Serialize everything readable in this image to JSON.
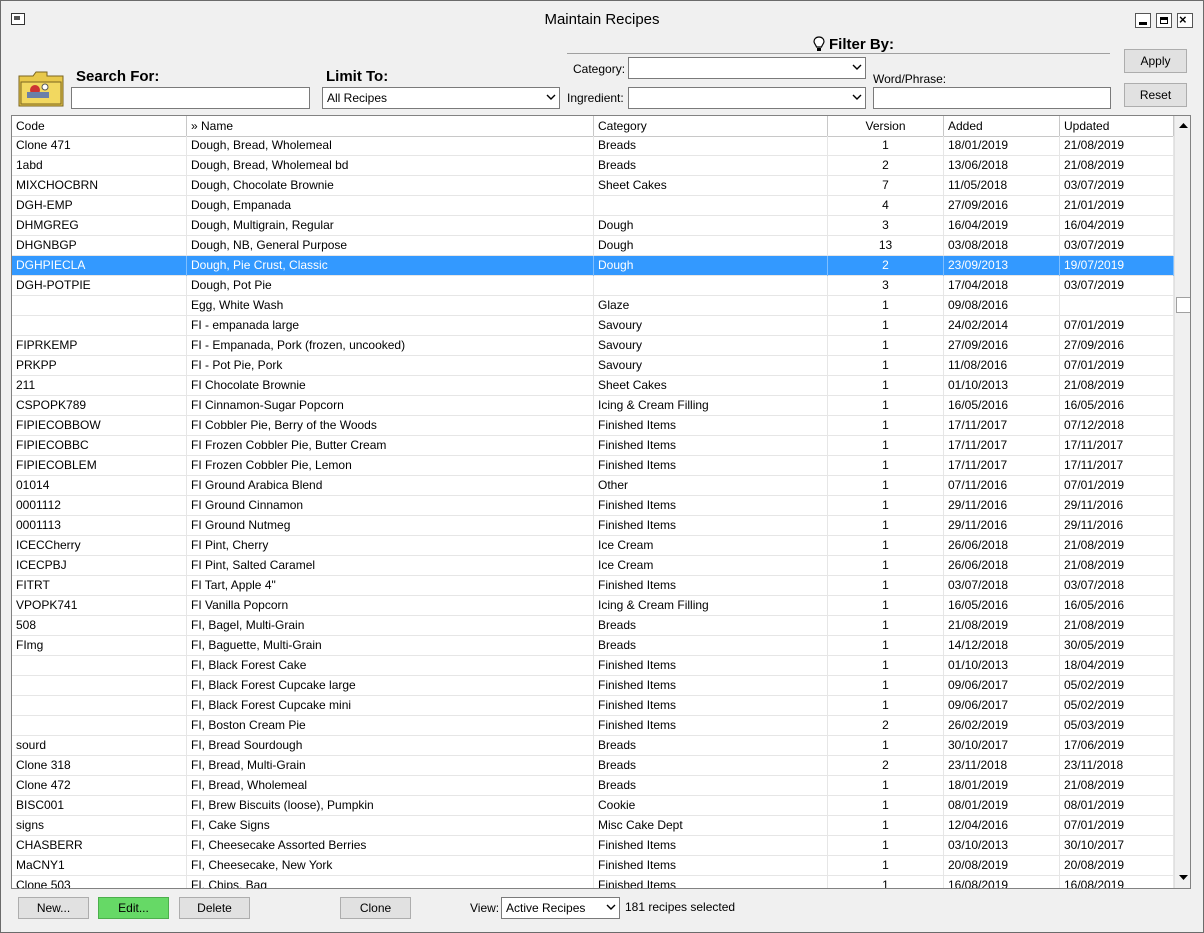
{
  "window": {
    "title": "Maintain Recipes"
  },
  "search": {
    "label": "Search For:",
    "value": ""
  },
  "limit": {
    "label": "Limit To:",
    "value": "All Recipes"
  },
  "filter": {
    "title": "Filter By:",
    "category_label": "Category:",
    "category_value": "",
    "ingredient_label": "Ingredient:",
    "ingredient_value": "",
    "word_label": "Word/Phrase:",
    "word_value": ""
  },
  "buttons": {
    "apply": "Apply",
    "reset": "Reset",
    "new": "New...",
    "edit": "Edit...",
    "delete": "Delete",
    "clone": "Clone"
  },
  "grid": {
    "columns": [
      "Code",
      "» Name",
      "Category",
      "Version",
      "Added",
      "Updated"
    ],
    "selected_index": 6,
    "rows": [
      [
        "Clone 471",
        "Dough, Bread, Wholemeal",
        "Breads",
        "1",
        "18/01/2019",
        "21/08/2019"
      ],
      [
        "1abd",
        "Dough, Bread, Wholemeal bd",
        "Breads",
        "2",
        "13/06/2018",
        "21/08/2019"
      ],
      [
        "MIXCHOCBRN",
        "Dough, Chocolate Brownie",
        "Sheet Cakes",
        "7",
        "11/05/2018",
        "03/07/2019"
      ],
      [
        "DGH-EMP",
        "Dough, Empanada",
        "",
        "4",
        "27/09/2016",
        "21/01/2019"
      ],
      [
        "DHMGREG",
        "Dough, Multigrain, Regular",
        "Dough",
        "3",
        "16/04/2019",
        "16/04/2019"
      ],
      [
        "DHGNBGP",
        "Dough, NB, General Purpose",
        "Dough",
        "13",
        "03/08/2018",
        "03/07/2019"
      ],
      [
        "DGHPIECLA",
        "Dough, Pie Crust, Classic",
        "Dough",
        "2",
        "23/09/2013",
        "19/07/2019"
      ],
      [
        "DGH-POTPIE",
        "Dough, Pot Pie",
        "",
        "3",
        "17/04/2018",
        "03/07/2019"
      ],
      [
        "",
        "Egg, White Wash",
        "Glaze",
        "1",
        "09/08/2016",
        ""
      ],
      [
        "",
        "FI - empanada large",
        "Savoury",
        "1",
        "24/02/2014",
        "07/01/2019"
      ],
      [
        "FIPRKEMP",
        "FI - Empanada, Pork (frozen, uncooked)",
        "Savoury",
        "1",
        "27/09/2016",
        "27/09/2016"
      ],
      [
        "PRKPP",
        "FI - Pot Pie, Pork",
        "Savoury",
        "1",
        "11/08/2016",
        "07/01/2019"
      ],
      [
        "211",
        "FI Chocolate Brownie",
        "Sheet Cakes",
        "1",
        "01/10/2013",
        "21/08/2019"
      ],
      [
        "CSPOPK789",
        "FI Cinnamon-Sugar Popcorn",
        "Icing & Cream Filling",
        "1",
        "16/05/2016",
        "16/05/2016"
      ],
      [
        "FIPIECOBBOW",
        "FI Cobbler Pie, Berry of the Woods",
        "Finished Items",
        "1",
        "17/11/2017",
        "07/12/2018"
      ],
      [
        "FIPIECOBBC",
        "FI Frozen Cobbler Pie, Butter Cream",
        "Finished Items",
        "1",
        "17/11/2017",
        "17/11/2017"
      ],
      [
        "FIPIECOBLEM",
        "FI Frozen Cobbler Pie, Lemon",
        "Finished Items",
        "1",
        "17/11/2017",
        "17/11/2017"
      ],
      [
        "01014",
        "FI Ground Arabica Blend",
        "Other",
        "1",
        "07/11/2016",
        "07/01/2019"
      ],
      [
        "0001112",
        "FI Ground Cinnamon",
        "Finished Items",
        "1",
        "29/11/2016",
        "29/11/2016"
      ],
      [
        "0001113",
        "FI Ground Nutmeg",
        "Finished Items",
        "1",
        "29/11/2016",
        "29/11/2016"
      ],
      [
        "ICECCherry",
        "FI Pint, Cherry",
        "Ice Cream",
        "1",
        "26/06/2018",
        "21/08/2019"
      ],
      [
        "ICECPBJ",
        "FI Pint, Salted Caramel",
        "Ice Cream",
        "1",
        "26/06/2018",
        "21/08/2019"
      ],
      [
        "FITRT",
        "FI Tart, Apple 4\"",
        "Finished Items",
        "1",
        "03/07/2018",
        "03/07/2018"
      ],
      [
        "VPOPK741",
        "FI Vanilla Popcorn",
        "Icing & Cream Filling",
        "1",
        "16/05/2016",
        "16/05/2016"
      ],
      [
        "508",
        "FI, Bagel, Multi-Grain",
        "Breads",
        "1",
        "21/08/2019",
        "21/08/2019"
      ],
      [
        "FImg",
        "FI, Baguette, Multi-Grain",
        "Breads",
        "1",
        "14/12/2018",
        "30/05/2019"
      ],
      [
        "",
        "FI, Black Forest Cake",
        "Finished Items",
        "1",
        "01/10/2013",
        "18/04/2019"
      ],
      [
        "",
        "FI, Black Forest Cupcake large",
        "Finished Items",
        "1",
        "09/06/2017",
        "05/02/2019"
      ],
      [
        "",
        "FI, Black Forest Cupcake mini",
        "Finished Items",
        "1",
        "09/06/2017",
        "05/02/2019"
      ],
      [
        "",
        "FI, Boston Cream Pie",
        "Finished Items",
        "2",
        "26/02/2019",
        "05/03/2019"
      ],
      [
        "sourd",
        "FI, Bread Sourdough",
        "Breads",
        "1",
        "30/10/2017",
        "17/06/2019"
      ],
      [
        "Clone 318",
        "FI, Bread, Multi-Grain",
        "Breads",
        "2",
        "23/11/2018",
        "23/11/2018"
      ],
      [
        "Clone 472",
        "FI, Bread, Wholemeal",
        "Breads",
        "1",
        "18/01/2019",
        "21/08/2019"
      ],
      [
        "BISC001",
        "FI, Brew Biscuits (loose), Pumpkin",
        "Cookie",
        "1",
        "08/01/2019",
        "08/01/2019"
      ],
      [
        "signs",
        "FI, Cake Signs",
        "Misc Cake Dept",
        "1",
        "12/04/2016",
        "07/01/2019"
      ],
      [
        "CHASBERR",
        "FI, Cheesecake Assorted Berries",
        "Finished Items",
        "1",
        "03/10/2013",
        "30/10/2017"
      ],
      [
        "MaCNY1",
        "FI, Cheesecake, New York",
        "Finished Items",
        "1",
        "20/08/2019",
        "20/08/2019"
      ],
      [
        "Clone 503",
        "FI, Chips, Bag",
        "Finished Items",
        "1",
        "16/08/2019",
        "16/08/2019"
      ]
    ]
  },
  "footer": {
    "view_label": "View:",
    "view_value": "Active Recipes",
    "status": "181 recipes selected"
  }
}
